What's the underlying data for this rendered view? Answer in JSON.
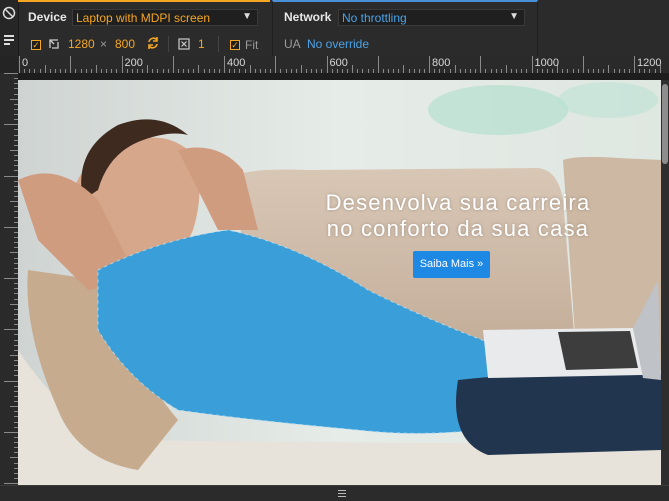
{
  "toolbar": {
    "device_label": "Device",
    "device_select": "Laptop with MDPI screen",
    "width": "1280",
    "times": "×",
    "height": "800",
    "dpr": "1",
    "fit_label": "Fit",
    "network_label": "Network",
    "network_select": "No throttling",
    "ua_label": "UA",
    "ua_value": "No override"
  },
  "ruler": {
    "labels": [
      "0",
      "200",
      "400",
      "600",
      "800",
      "1000",
      "1200"
    ]
  },
  "page": {
    "headline_line1": "Desenvolva sua carreira",
    "headline_line2": "no conforto da sua casa",
    "cta_label": "Saiba Mais »"
  },
  "colors": {
    "device_accent": "#f5a623",
    "network_accent": "#4a90d9",
    "cta": "#1e88e5"
  }
}
